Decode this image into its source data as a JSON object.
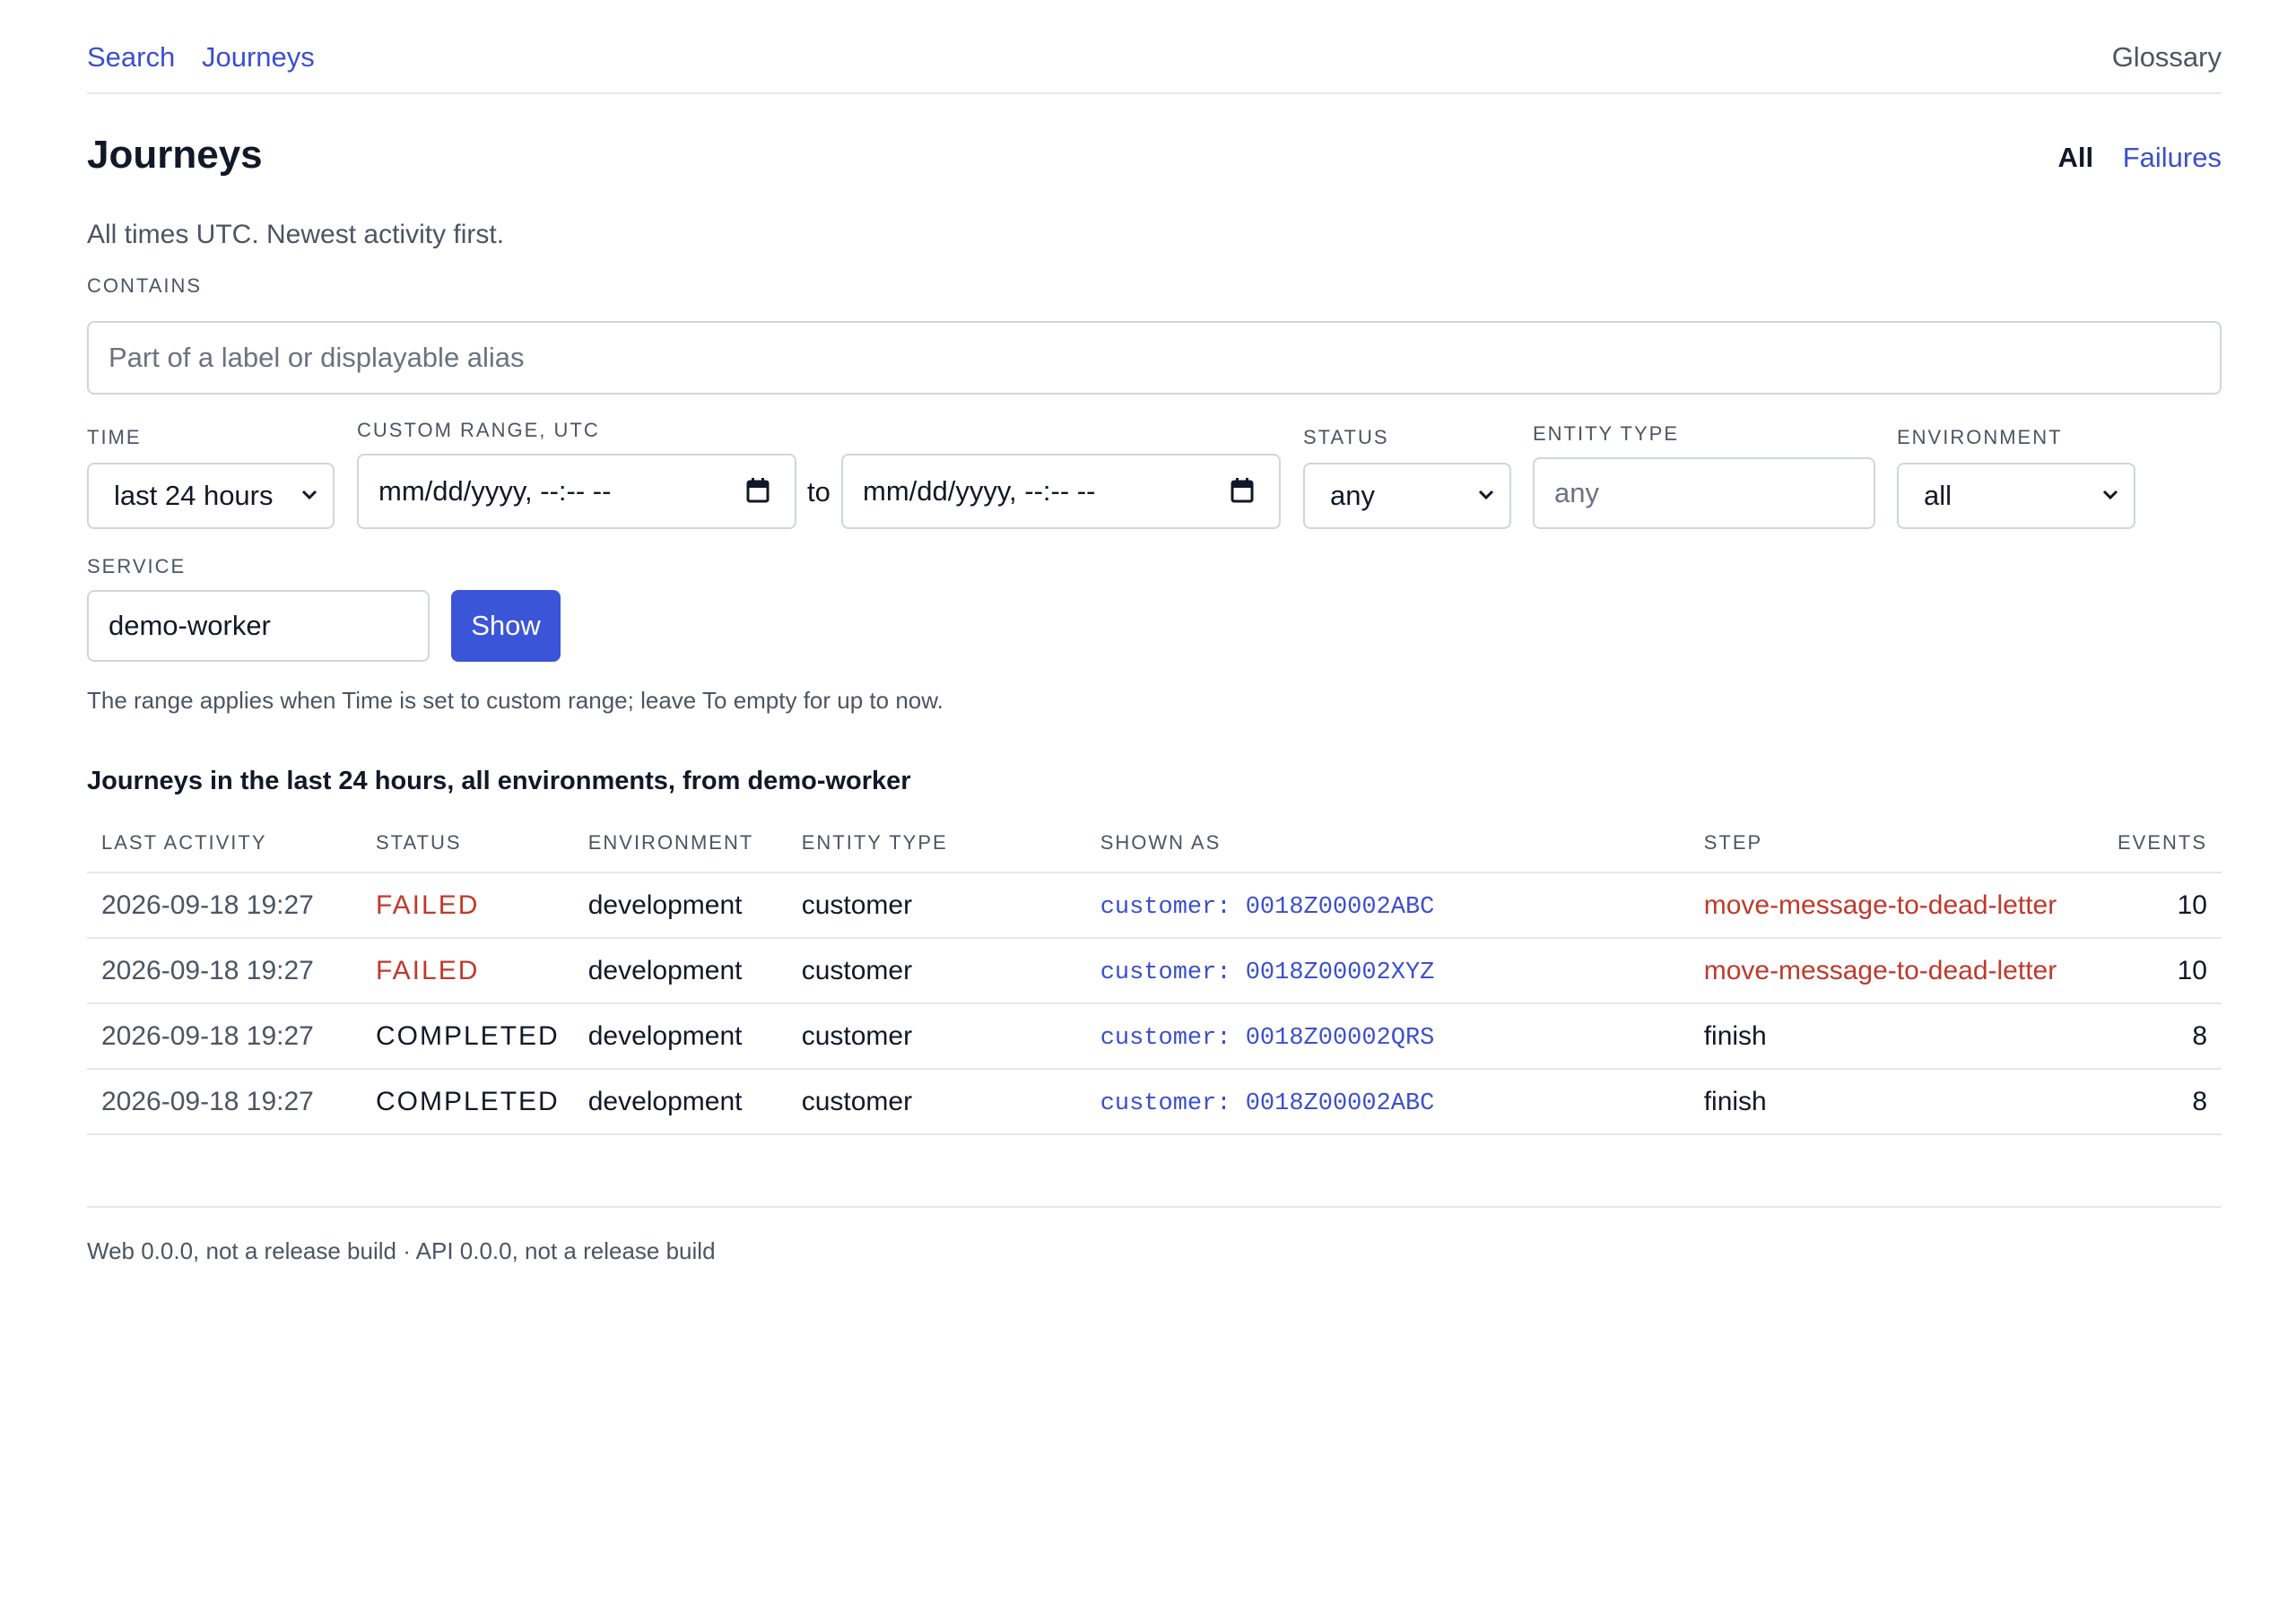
{
  "nav": {
    "search": "Search",
    "journeys": "Journeys",
    "glossary": "Glossary"
  },
  "header": {
    "title": "Journeys",
    "tab_all": "All",
    "tab_failures": "Failures",
    "subtitle": "All times UTC. Newest activity first."
  },
  "filters": {
    "contains_label": "Contains",
    "contains_placeholder": "Part of a label or displayable alias",
    "contains_value": "",
    "time_label": "Time",
    "time_value": "last 24 hours",
    "range_label": "Custom range, UTC",
    "range_from_value": "mm/dd/yyyy, --:-- --",
    "range_to_label": "to",
    "range_to_value": "mm/dd/yyyy, --:-- --",
    "status_label": "Status",
    "status_value": "any",
    "entity_type_label": "Entity type",
    "entity_type_placeholder": "any",
    "environment_label": "Environment",
    "environment_value": "all",
    "service_label": "Service",
    "service_value": "demo-worker",
    "show_button": "Show",
    "help_text": "The range applies when Time is set to custom range; leave To empty for up to now."
  },
  "results": {
    "heading": "Journeys in the last 24 hours, all environments, from demo-worker",
    "columns": {
      "last_activity": "Last activity",
      "status": "Status",
      "environment": "Environment",
      "entity_type": "Entity type",
      "shown_as": "Shown as",
      "step": "Step",
      "events": "Events"
    },
    "rows": [
      {
        "last_activity": "2026-09-18 19:27",
        "status": "FAILED",
        "environment": "development",
        "entity_type": "customer",
        "shown_as": "customer: 0018Z00002ABC",
        "step": "move-message-to-dead-letter",
        "events": "10"
      },
      {
        "last_activity": "2026-09-18 19:27",
        "status": "FAILED",
        "environment": "development",
        "entity_type": "customer",
        "shown_as": "customer: 0018Z00002XYZ",
        "step": "move-message-to-dead-letter",
        "events": "10"
      },
      {
        "last_activity": "2026-09-18 19:27",
        "status": "COMPLETED",
        "environment": "development",
        "entity_type": "customer",
        "shown_as": "customer: 0018Z00002QRS",
        "step": "finish",
        "events": "8"
      },
      {
        "last_activity": "2026-09-18 19:27",
        "status": "COMPLETED",
        "environment": "development",
        "entity_type": "customer",
        "shown_as": "customer: 0018Z00002ABC",
        "step": "finish",
        "events": "8"
      }
    ]
  },
  "footer": {
    "text": "Web 0.0.0, not a release build · API 0.0.0, not a release build"
  },
  "colors": {
    "link": "#3b4fcf",
    "primary_button": "#3b55d9",
    "failed": "#c0392b",
    "muted_text": "#4b5563",
    "border": "#e5e7eb"
  },
  "icons": {
    "select_chevron": "chevron-down-icon",
    "date_picker": "calendar-icon"
  }
}
